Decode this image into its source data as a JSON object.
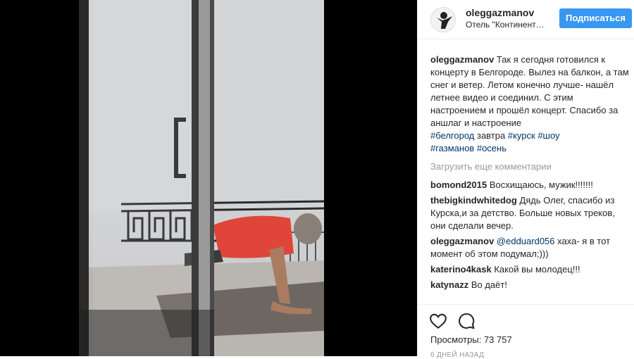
{
  "post": {
    "username": "oleggazmanov",
    "location": "Отель \"Континент…",
    "follow_label": "Подписаться",
    "caption": {
      "user": "oleggazmanov",
      "text": "Так я сегодня готовился к концерту в Белгороде. Вылез на балкон, а там снег и ветер. Летом конечно лучше- нашёл летнее видео и соединил. С этим настроением и прошёл концерт. Спасибо за аншлаг и настроение",
      "tag1": "#белгород",
      "word1": "завтра",
      "tag2": "#курск",
      "tag3": "#шоу",
      "tag4": "#газманов",
      "tag5": "#осень"
    },
    "load_more": "Загрузить еще комментарии",
    "comments": [
      {
        "user": "bomond2015",
        "text": "Восхищаюсь, мужик!!!!!!!"
      },
      {
        "user": "thebigkindwhitedog",
        "text": "Дядь Олег, спасибо из Курска,и за детство. Больше новых треков, они сделали вечер."
      },
      {
        "user": "oleggazmanov",
        "mention": "@edduard056",
        "text": "хаха- я в тот момент об этом подумал;)))"
      },
      {
        "user": "katerino4kask",
        "text": "Какой вы молодец!!!"
      },
      {
        "user": "katynazz",
        "text": "Во даёт!"
      }
    ],
    "views_label": "Просмотры:",
    "views_count": "73 757",
    "time_ago": "6 дней назад"
  },
  "icons": {
    "like": "heart-icon",
    "comment": "comment-icon"
  },
  "colors": {
    "follow_button": "#3897f0",
    "hashtag": "#003569",
    "muted": "#999999"
  }
}
